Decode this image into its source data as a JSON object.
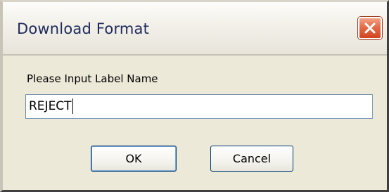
{
  "window": {
    "title": "Download Format",
    "close_icon": "close-x-icon"
  },
  "form": {
    "label": "Please Input Label Name",
    "input_value": "REJECT"
  },
  "buttons": {
    "ok_label": "OK",
    "cancel_label": "Cancel"
  },
  "colors": {
    "dialog_bg": "#ece9d8",
    "close_button": "#e0593a",
    "title_text": "#1e2a5c",
    "button_border": "#003c74"
  }
}
